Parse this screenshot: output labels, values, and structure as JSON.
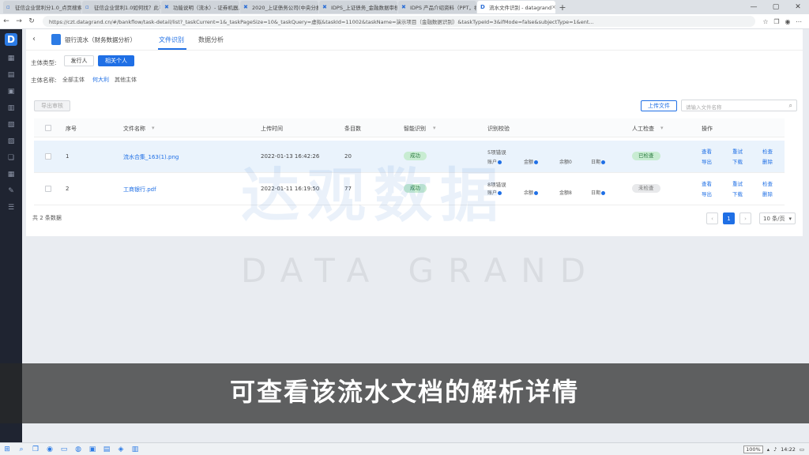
{
  "browser": {
    "tabs": [
      {
        "label": "征信企业营利分1.0_点页搜索",
        "active": false
      },
      {
        "label": "征信企业营利1.0如何找？此",
        "active": false
      },
      {
        "label": "功能说明（流水）- 证券机器人",
        "active": false
      },
      {
        "label": "2020_上证债务公司(中央分报)",
        "active": false
      },
      {
        "label": "IDPS_上证债务_金融数据审核",
        "active": false
      },
      {
        "label": "IDPS 产品介绍资料（PPT，视频）",
        "active": false
      },
      {
        "label": "流水文件识别 - datagrand",
        "active": true
      }
    ],
    "url": "https://czt.datagrand.cn/#/bankflow/task-detail/list?_taskCurrent=1&_taskPageSize=10&_taskQuery=虚拟&taskId=11002&taskName=演示项目（金融数据识别）&taskTypeId=3&ifMode=false&subjectType=1&ent..."
  },
  "page": {
    "title": "银行流水（财务数据分析）",
    "tabs": [
      "文件识别",
      "数据分析"
    ],
    "subject_type_label": "主体类型:",
    "subject_buttons": [
      "发行人",
      "相关个人"
    ],
    "subject_name_label": "主体名称:",
    "subject_filters": [
      "全部主体",
      "何大利",
      "其他主体"
    ],
    "export_button": "导出审核",
    "upload_button": "上传文件",
    "search_placeholder": "请输入文件名称"
  },
  "table": {
    "headers": [
      "序号",
      "文件名称",
      "上传时间",
      "条目数",
      "智能识别",
      "识别校验",
      "人工检查",
      "操作"
    ],
    "rows": [
      {
        "index": "1",
        "filename": "流水合集_163(1).png",
        "uploaded": "2022-01-13 16:42:26",
        "count": "20",
        "recognition": "成功",
        "check_title": "5项错误",
        "check_items": [
          "账户",
          "金额",
          "余额0",
          "日期"
        ],
        "review": "已检查",
        "actions": [
          "查看",
          "重试",
          "检查",
          "导出",
          "下载",
          "删除"
        ]
      },
      {
        "index": "2",
        "filename": "工商银行.pdf",
        "uploaded": "2022-01-11 16:19:50",
        "count": "77",
        "recognition": "成功",
        "check_title": "8项错误",
        "check_items": [
          "账户",
          "余额",
          "金额8",
          "日期"
        ],
        "review": "未检查",
        "actions": [
          "查看",
          "重试",
          "检查",
          "导出",
          "下载",
          "删除"
        ]
      }
    ]
  },
  "footer": {
    "total": "共 2 条数据",
    "current_page": "1",
    "page_size": "10 条/页"
  },
  "watermark": {
    "cn": "达观数据",
    "en": "DATA GRAND"
  },
  "caption": "可查看该流水文档的解析详情",
  "taskbar": {
    "zoom": "100%",
    "time": "14:22"
  }
}
